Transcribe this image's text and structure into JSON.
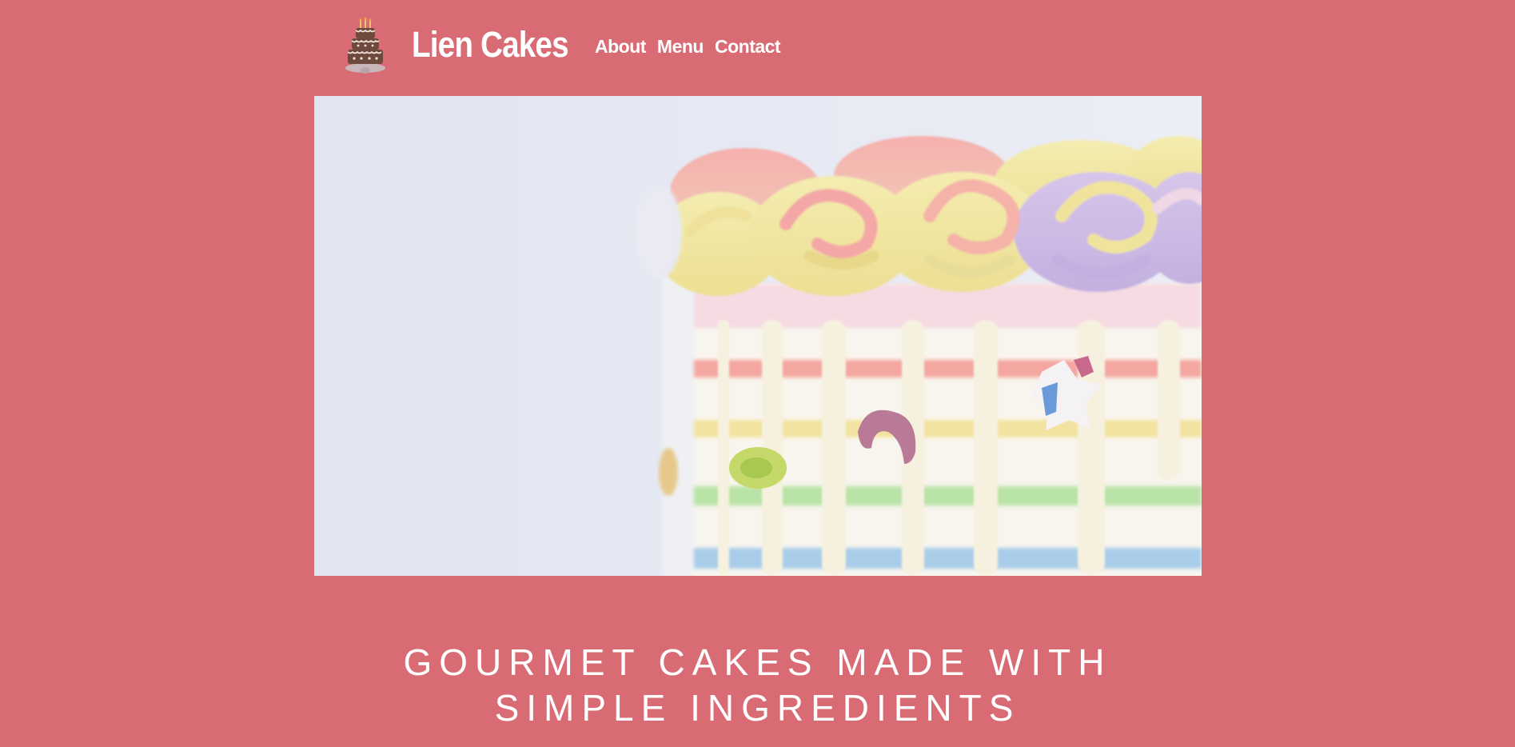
{
  "brand": {
    "name": "Lien Cakes",
    "logo_icon": "cake-icon"
  },
  "nav": {
    "items": [
      {
        "label": "About"
      },
      {
        "label": "Menu"
      },
      {
        "label": "Contact"
      }
    ]
  },
  "hero": {
    "image": "rainbow-drip-cake"
  },
  "tagline": {
    "line1": "GOURMET CAKES MADE WITH",
    "line2": "SIMPLE INGREDIENTS"
  },
  "colors": {
    "background": "#d96b74",
    "text": "#ffffff"
  }
}
